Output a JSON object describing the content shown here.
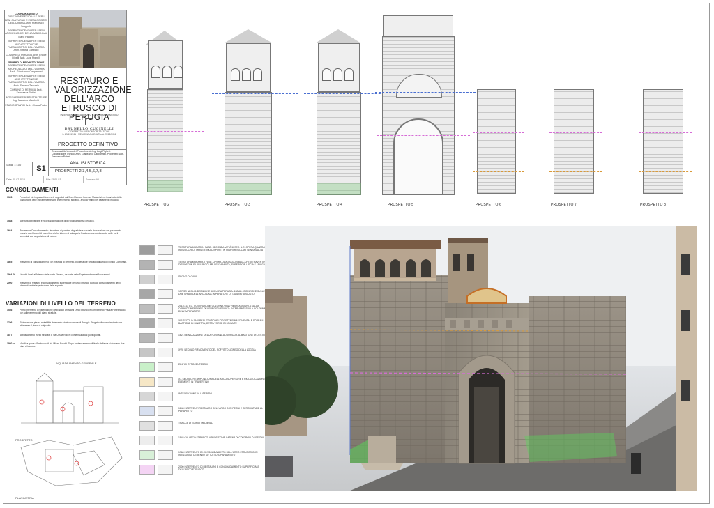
{
  "credits": [
    {
      "h": "COORDINAMENTO",
      "c": "DIREZIONE REGIONALE PER I BENI CULTURALI E PAESAGGISTICI DELL'UMBRIA Arch. Francesco Scoppola"
    },
    {
      "h": "",
      "c": "SOPRINTENDENZA PER I BENI ARCHEOLOGICI DELL'UMBRIA Dott. Mario Pagano"
    },
    {
      "h": "",
      "c": "SOPRINTENDENZA PER I BENI ARCHITETTONICI E PAESAGGISTICI DELL'UMBRIA Arch. Vittoria Garibaldi"
    },
    {
      "h": "",
      "c": "COMUNE DI PERUGIA Arch. Ercole Dinelli Arch. Luigi Pighelli"
    },
    {
      "h": "GRUPPO DI PROGETTAZIONE",
      "c": "SOPRINTENDENZA PER I BENI ARCHEOLOGICI DELL'UMBRIA Arch. Gianfranco Cappannini"
    },
    {
      "h": "",
      "c": "SOPRINTENDENZA PER I BENI ARCHITETTONICI E PAESAGGISTICI DELL'UMBRIA Arch. Stefano Zaccaria"
    },
    {
      "h": "",
      "c": "COMUNE DI PERUGIA Dott. Francesca Patrizi"
    },
    {
      "h": "",
      "c": "INGEGNERI ESPERTI STRUTTURE Ing. Massimo Marchetti"
    },
    {
      "h": "",
      "c": "STUDIO GRAFICI Arch. Chiara Fratini"
    }
  ],
  "title": {
    "main": "RESTAURO E VALORIZZAZIONE DELL'ARCO ETRUSCO DI PERUGIA",
    "sub": "INTERVENTO REALIZZATO CON FINANZIAMENTO",
    "studio_name": "BRUNELLO CUCINELLI",
    "studio_sub": "CONTRATTO DI SPONSORIZZAZIONE",
    "studio_sub2": "IL 29/11/2011 - MEMORIA ALLEGATA AL 27/12/2011",
    "phase": "PROGETTO DEFINITIVO",
    "resp": "Responsabile Unico del Procedimento Ing. Luigi Pighelli. Collaboratore Tecnico: Arch. Gianfranco Cappannini. Progettisti: Dott. Francesca Patrizi",
    "analysis": "ANALISI STORICA",
    "prospects": "PROSPETTI  2,3,4,5,6,7,8",
    "scale": "Scala: 1:100",
    "code": "S1",
    "date": "Data: 15.07.2013",
    "file": "File: ES01-S1",
    "format": "Formato: A1"
  },
  "elevations": [
    {
      "label": "PROSPETTO 2"
    },
    {
      "label": "PROSPETTO 3"
    },
    {
      "label": "PROSPETTO 4"
    },
    {
      "label": "PROSPETTO 5"
    },
    {
      "label": "PROSPETTO 6"
    },
    {
      "label": "PROSPETTO 7"
    },
    {
      "label": "PROSPETTO 8"
    }
  ],
  "consolidamenti": {
    "title": "CONSOLIDAMENTI",
    "entries": [
      {
        "y": "1328",
        "t": "Prima fra i più importanti interventi segnalati sull'Arco Etrusco. Lorenzo Maitani viene incaricato della costruzione delle mura trecentesche intervenendo sull'arco, ancora visibili nel paramento murario."
      },
      {
        "y": "1588",
        "t": "Apertura di botteghe e nuova sistemazione degli spazi a ridosso dell'arco."
      },
      {
        "y": "1664",
        "t": "Restauro e Consolidamento: rimozione di porzioni degradate e parziale ricostruzione del paramento murario con blocchi di travertino e tufo, interventi sulla porta Pulchra e consolidamento delle parti sommitali con apposizione di catene."
      },
      {
        "y": "1865",
        "t": "Intervento di consolidamento con iniezioni di cemento, progettato e seguito dall'Ufficio Tecnico Comunale."
      },
      {
        "y": "1904-06",
        "t": "Uso dei locali all'interno della porta Etrusca, da parte della Soprintendenza ai Monumenti."
      },
      {
        "y": "2000",
        "t": "Interventi di restauro e consolidamento superficiale dell'arco etrusco: pulitura, consolidamento degli elementi lapidei e protezione delle superfici."
      }
    ]
  },
  "variazioni": {
    "title": "VARIAZIONI DI LIVELLO DEL TERRENO",
    "entries": [
      {
        "y": "1536",
        "t": "Primo intervento di sistemazione degli spazi antistanti l'Arco Etrusco e l'ambiente di Piazza Fortebraccio, con sollevamento del piano stradale."
      },
      {
        "y": "1796",
        "t": "Sistemazione piazza e viabilità. Intervento storico comune di Perugia. Progetto di nuovo impianto per abbassare il piano di calpestio."
      },
      {
        "y": "1877",
        "t": "Abbassamento livello stradale di via Ulisse Rocchi come risulta dai punti quotati."
      },
      {
        "y": "1950 ca.",
        "t": "Modifica quota all'imbocco di via Ulisse Rocchi. Dopo l'abbassamento di livello della via si ricavano due piani di transito."
      }
    ]
  },
  "sketch": {
    "title": "INQUADRAMENTO GENERALE",
    "prospetto": "PROSPETTO",
    "planimetria": "PLANIMETRIA"
  },
  "legend": [
    {
      "c": "#9d9d9d",
      "t": "TESSITURA MURARIA I FASE. SECONDA METÀ III SEC. A.C. OPERA QUADRATA IN BLOCCHI DI TRAVERTINO DISPOSTI IN FILARI REGOLARI SENZA MALTA"
    },
    {
      "c": "#b3b3b3",
      "t": "TESSITURA MURARIA II FASE. OPERA QUADRATA IN BLOCCHI DI TRAVERTINO DISPOSTI IN FILARI REGOLARI SENZA MALTA, SUPERFICIE LISCIA E LEVIGATA"
    },
    {
      "c": "#cfcfcf",
      "t": "SEGNO DI CAVA"
    },
    {
      "c": "#a7a7a7",
      "t": "VERSO NEGLI 1 DEDIZIONE AUGUSTA PERUSIA. 132 AD. ISCRIZIONE SULLE DUE CHIAVI DELL'ARCO DALL'IMPERATORE OTTAVIANO AUGUSTO"
    },
    {
      "c": "#bdbdbd",
      "t": "2011/313 d.C. COSTRUZIONE COLONNA VIBIA VIBIUS AGGIUNTA SULLA CORNICE INFERIORE DEL FREGIO MERLATO. INTERVENTI SULLA COLONNA DELL'IMPERATORE"
    },
    {
      "c": "#a9a9a9",
      "t": "XVI SECOLO 1540 REALIZZAZIONE LOGGETTA RINASCIMENTALE SOPRA IL BASTIONE DI SINISTRA, DETTA TORRE DI LEVANTE"
    },
    {
      "c": "#b7b7b7",
      "t": "1621 REALIZZAZIONE DELLA FONTANA ADDOSSATA AL BASTIONE DI DESTRA"
    },
    {
      "c": "#c6c6c6",
      "t": "XVIII SECOLO RIFACIMENTO DEL SOFFITTO LIGNEO DELLA LOGGIA"
    },
    {
      "c": "#c9f0c9",
      "t": "EDIFICI OTTOCENTESCHI"
    },
    {
      "c": "#f6e7c6",
      "t": "XX SECOLO RITAMPONATURA DELL'ARCO SUPERIORE E RICOLLOCAZIONE DI ELEMENTI IN TRAVERTINO"
    },
    {
      "c": "#d6d6d6",
      "t": "INTEGRAZIONE IN LATERIZIO"
    },
    {
      "c": "#d8e0f0",
      "t": "1848 INTERVENTI RESTAURO DELL'ARCO CON PERNI E CERCHIATURE AL PARAPETTO"
    },
    {
      "c": "#e0e0e0",
      "t": "TRACCE DI EDIFICI MEDIEVALI"
    },
    {
      "c": "#ededed",
      "t": "1948 CA. ARCO ETRUSCO: APPOSIZIONE CATENA DI CONTROLLO LESIONI"
    },
    {
      "c": "#d8f0d8",
      "t": "1968 INTERVENTO DI CONSOLIDAMENTO DELL'ARCO ETRUSCO CON INIEZIONI DI CEMENTO SU TUTTO IL PARAMENTO"
    },
    {
      "c": "#f4d4f4",
      "t": "2000 INTERVENTO DI RESTAURO E CONSOLIDAMENTO SUPERFICIALE DELL'ARCO ETRUSCO"
    }
  ]
}
